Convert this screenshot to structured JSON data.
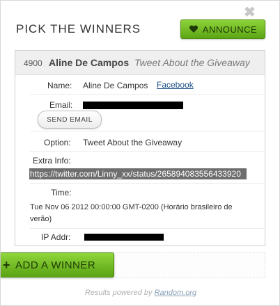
{
  "header": {
    "title": "PICK THE WINNERS",
    "announce_label": "ANNOUNCE"
  },
  "winner": {
    "entry_number": "4900",
    "name": "Aline De Campos",
    "method": "Tweet About the Giveaway",
    "fields": {
      "name_label": "Name:",
      "name_value": "Aline De Campos",
      "facebook_link": "Facebook",
      "email_label": "Email:",
      "send_email_label": "SEND EMAIL",
      "option_label": "Option:",
      "option_value": "Tweet About the Giveaway",
      "extra_info_label": "Extra Info:",
      "extra_info_value": "https://twitter.com/Linny_xx/status/265894083556433920",
      "time_label": "Time:",
      "time_value": "Tue Nov 06 2012 00:00:00 GMT-0200 (Horário brasileiro de verão)",
      "ip_label": "IP Addr:"
    }
  },
  "add_winner_label": "ADD A WINNER",
  "footer": {
    "prefix": "Results powered by ",
    "link": "Random.org"
  },
  "colors": {
    "accent_green": "#6dbb22",
    "link_blue": "#1b4f86"
  }
}
